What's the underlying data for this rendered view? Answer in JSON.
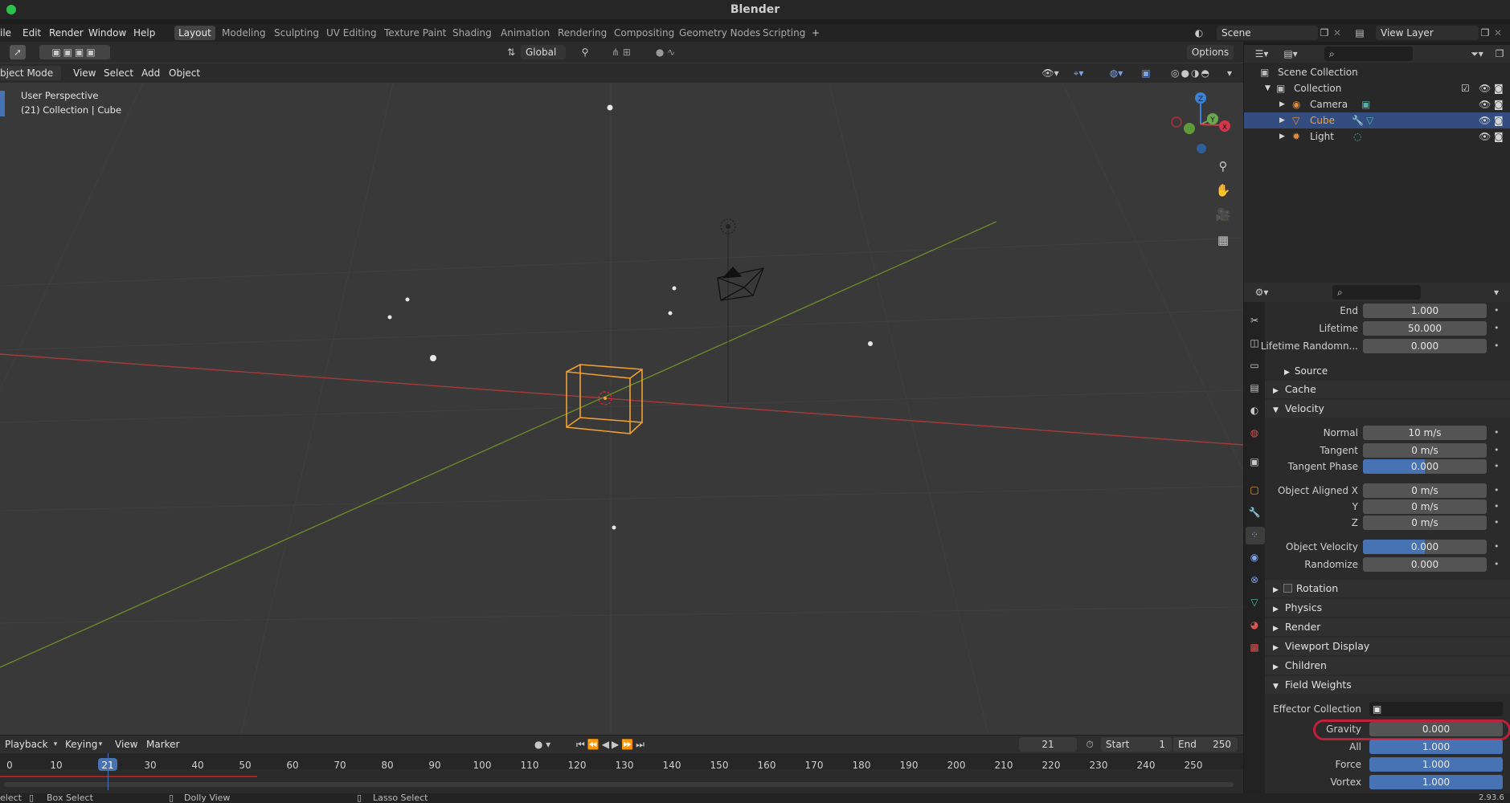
{
  "window": {
    "title": "Blender"
  },
  "menus": [
    "ile",
    "Edit",
    "Render",
    "Window",
    "Help"
  ],
  "workspaces": [
    {
      "label": "Layout",
      "active": true
    },
    {
      "label": "Modeling"
    },
    {
      "label": "Sculpting"
    },
    {
      "label": "UV Editing"
    },
    {
      "label": "Texture Paint"
    },
    {
      "label": "Shading"
    },
    {
      "label": "Animation"
    },
    {
      "label": "Rendering"
    },
    {
      "label": "Compositing"
    },
    {
      "label": "Geometry Nodes"
    },
    {
      "label": "Scripting"
    }
  ],
  "topright": {
    "scene": "Scene",
    "view_layer": "View Layer"
  },
  "tool_header": {
    "orientation": "Global",
    "options": "Options"
  },
  "viewport_header": {
    "mode": "bject Mode",
    "menus": [
      "View",
      "Select",
      "Add",
      "Object"
    ]
  },
  "viewport": {
    "perspective_label": "User Perspective",
    "context_label": "(21) Collection | Cube"
  },
  "gizmo": {
    "z": "Z",
    "y": "Y",
    "x": "X"
  },
  "outliner": {
    "scene_collection": "Scene Collection",
    "collection": "Collection",
    "items": [
      {
        "label": "Camera"
      },
      {
        "label": "Cube",
        "selected": true
      },
      {
        "label": "Light"
      }
    ]
  },
  "properties": {
    "emission_tail": [
      {
        "label": "End",
        "value": "1.000"
      },
      {
        "label": "Lifetime",
        "value": "50.000"
      },
      {
        "label": "Lifetime Randomn...",
        "value": "0.000"
      }
    ],
    "source_label": "Source",
    "cache_label": "Cache",
    "velocity_label": "Velocity",
    "velocity": [
      {
        "label": "Normal",
        "value": "10 m/s"
      },
      {
        "label": "Tangent",
        "value": "0 m/s"
      },
      {
        "label": "Tangent Phase",
        "value": "0.000"
      },
      {
        "label": "Object Aligned X",
        "value": "0 m/s"
      },
      {
        "label": "Y",
        "value": "0 m/s"
      },
      {
        "label": "Z",
        "value": "0 m/s"
      },
      {
        "label": "Object Velocity",
        "value": "0.000"
      },
      {
        "label": "Randomize",
        "value": "0.000"
      }
    ],
    "collapsed_panels": [
      "Rotation",
      "Physics",
      "Render",
      "Viewport Display",
      "Children"
    ],
    "field_weights_label": "Field Weights",
    "effector_collection_label": "Effector Collection",
    "field_weights": [
      {
        "label": "Gravity",
        "value": "0.000",
        "fill": 0
      },
      {
        "label": "All",
        "value": "1.000",
        "fill": 1
      },
      {
        "label": "Force",
        "value": "1.000",
        "fill": 1
      },
      {
        "label": "Vortex",
        "value": "1.000",
        "fill": 1
      }
    ]
  },
  "timeline": {
    "menus": [
      "Playback",
      "Keying",
      "View",
      "Marker"
    ],
    "current_frame": "21",
    "start_label": "Start",
    "start": "1",
    "end_label": "End",
    "end": "250",
    "ticks": [
      "0",
      "10",
      "21",
      "30",
      "40",
      "50",
      "60",
      "70",
      "80",
      "90",
      "100",
      "110",
      "120",
      "130",
      "140",
      "150",
      "160",
      "170",
      "180",
      "190",
      "200",
      "210",
      "220",
      "230",
      "240",
      "250"
    ]
  },
  "statusbar": {
    "select": "elect",
    "box_select": "Box Select",
    "dolly_view": "Dolly View",
    "lasso_select": "Lasso Select",
    "version": "2.93.6"
  },
  "colors": {
    "accent": "#4772b3",
    "selected_object": "#f0a030",
    "highlight_ring": "#c0203a"
  }
}
